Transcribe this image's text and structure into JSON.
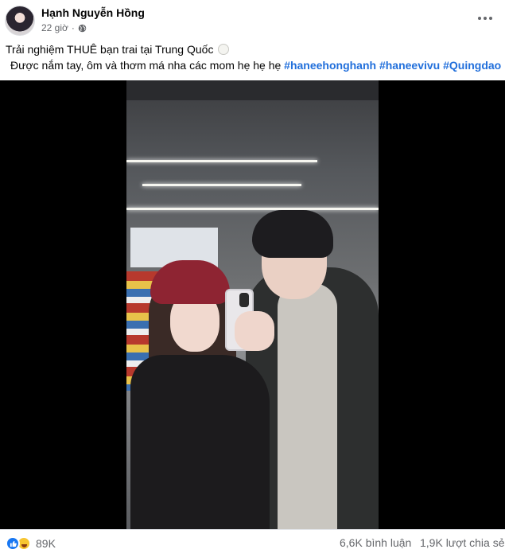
{
  "post": {
    "author": "Hạnh Nguyễn Hồng",
    "time": "22 giờ",
    "separator": "·",
    "caption_line1": "Trải nghiệm THUÊ bạn trai tại Trung Quốc",
    "caption_line2_text": "Được nắm tay, ôm và thơm má nha các mom hẹ hẹ hẹ",
    "hashtags": [
      "#haneehonghanh",
      "#haneevivu",
      "#Quingdao"
    ]
  },
  "footer": {
    "reactions_count": "89K",
    "comments": "6,6K bình luận",
    "shares": "1,9K lượt chia sẻ"
  },
  "icons": {
    "privacy": "globe-icon",
    "more": "more-icon",
    "reactions": [
      "like-icon",
      "haha-icon"
    ]
  },
  "colors": {
    "hashtag": "#216fdb",
    "meta": "#65676b",
    "like": "#1877f2"
  }
}
